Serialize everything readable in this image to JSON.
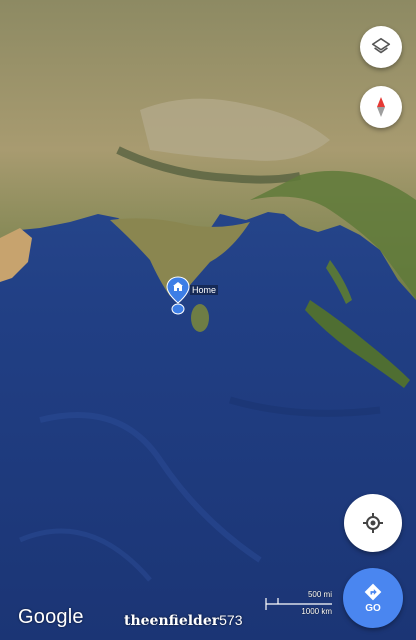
{
  "map": {
    "type": "satellite",
    "region": "Indian Ocean / South Asia"
  },
  "controls": {
    "layers_icon": "layers-icon",
    "compass_icon": "compass-icon",
    "location_icon": "my-location-icon",
    "go_icon": "directions-icon",
    "go_label": "GO"
  },
  "marker": {
    "label": "Home",
    "icon": "home-icon"
  },
  "footer": {
    "logo": "Google",
    "watermark_name": "theenfielder",
    "watermark_num": "573"
  },
  "scale": {
    "miles": "500 mi",
    "km": "1000 km"
  },
  "colors": {
    "ocean": "#1e3f86",
    "go_button": "#4a86f0",
    "pin": "#3d7ee6"
  }
}
